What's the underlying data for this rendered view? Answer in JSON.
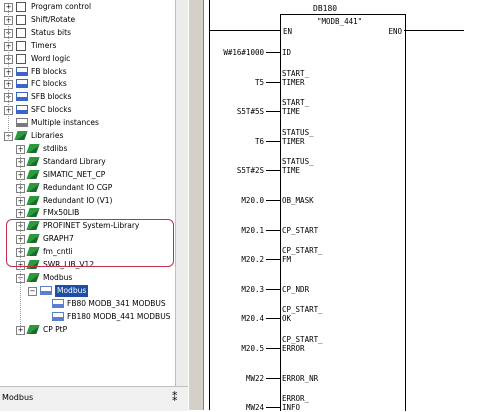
{
  "tree": {
    "items": [
      {
        "label": "Program control",
        "icon": "folder-icon",
        "expander": "+",
        "level": 1
      },
      {
        "label": "Shift/Rotate",
        "icon": "folder-icon",
        "expander": "+",
        "level": 1
      },
      {
        "label": "Status bits",
        "icon": "folder-icon",
        "expander": "+",
        "level": 1
      },
      {
        "label": "Timers",
        "icon": "folder-icon",
        "expander": "+",
        "level": 1
      },
      {
        "label": "Word logic",
        "icon": "folder-icon",
        "expander": "+",
        "level": 1
      },
      {
        "label": "FB blocks",
        "icon": "fb-block-icon",
        "expander": "+",
        "level": 1
      },
      {
        "label": "FC blocks",
        "icon": "fc-block-icon",
        "expander": "+",
        "level": 1
      },
      {
        "label": "SFB blocks",
        "icon": "sfb-block-icon",
        "expander": "+",
        "level": 1
      },
      {
        "label": "SFC blocks",
        "icon": "sfc-block-icon",
        "expander": "+",
        "level": 1
      },
      {
        "label": "Multiple instances",
        "icon": "multi-instance-icon",
        "expander": "",
        "level": 1
      },
      {
        "label": "Libraries",
        "icon": "library-icon",
        "expander": "-",
        "level": 1
      },
      {
        "label": "stdlibs",
        "icon": "library-icon",
        "expander": "+",
        "level": 2
      },
      {
        "label": "Standard Library",
        "icon": "library-icon",
        "expander": "+",
        "level": 2
      },
      {
        "label": "SIMATIC_NET_CP",
        "icon": "library-icon",
        "expander": "+",
        "level": 2
      },
      {
        "label": "Redundant IO CGP",
        "icon": "library-icon",
        "expander": "+",
        "level": 2
      },
      {
        "label": "Redundant IO (V1)",
        "icon": "library-icon",
        "expander": "+",
        "level": 2
      },
      {
        "label": "FMx50LIB",
        "icon": "library-icon",
        "expander": "+",
        "level": 2
      },
      {
        "label": "PROFINET System-Library",
        "icon": "library-icon",
        "expander": "+",
        "level": 2
      },
      {
        "label": "GRAPH7",
        "icon": "library-icon",
        "expander": "+",
        "level": 2
      },
      {
        "label": "fm_cntli",
        "icon": "library-icon",
        "expander": "+",
        "level": 2
      },
      {
        "label": "SWR_LIB_V12",
        "icon": "library-icon",
        "expander": "+",
        "level": 2
      },
      {
        "label": "Modbus",
        "icon": "library-icon",
        "expander": "-",
        "level": 2
      },
      {
        "label": "Modbus",
        "icon": "block-folder-icon",
        "expander": "-",
        "level": 3,
        "selected": true
      },
      {
        "label": "FB80   MODB_341   MODBUS",
        "icon": "function-block-icon",
        "expander": "",
        "level": 4
      },
      {
        "label": "FB180   MODB_441   MODBUS",
        "icon": "function-block-icon",
        "expander": "",
        "level": 4
      },
      {
        "label": "CP PtP",
        "icon": "library-icon",
        "expander": "+",
        "level": 2
      }
    ]
  },
  "status": {
    "text": "Modbus",
    "help_icon": "help-cursor-icon"
  },
  "block": {
    "db": "DB180",
    "name": "\"MODB_441\"",
    "en": "EN",
    "eno": "ENO",
    "inputs": [
      {
        "actual": "W#16#1000",
        "pin": "ID"
      },
      {
        "actual": "T5",
        "pin": "START_\nTIMER"
      },
      {
        "actual": "S5T#5S",
        "pin": "START_\nTIME"
      },
      {
        "actual": "T6",
        "pin": "STATUS_\nTIMER"
      },
      {
        "actual": "S5T#2S",
        "pin": "STATUS_\nTIME"
      },
      {
        "actual": "M20.0",
        "pin": "OB_MASK"
      },
      {
        "actual": "M20.1",
        "pin": "CP_START"
      },
      {
        "actual": "M20.2",
        "pin": "CP_START_\nFM"
      },
      {
        "actual": "M20.3",
        "pin": "CP_NDR"
      },
      {
        "actual": "M20.4",
        "pin": "CP_START_\nOK"
      },
      {
        "actual": "M20.5",
        "pin": "CP_START_\nERROR"
      },
      {
        "actual": "MW22",
        "pin": "ERROR_NR"
      },
      {
        "actual": "MW24",
        "pin": "ERROR_\nINFO"
      }
    ]
  },
  "colors": {
    "selection": "#1e4fa3",
    "highlight_frame": "#c0304a",
    "folder": "#e8c23a",
    "library": "#2a9a3a"
  }
}
